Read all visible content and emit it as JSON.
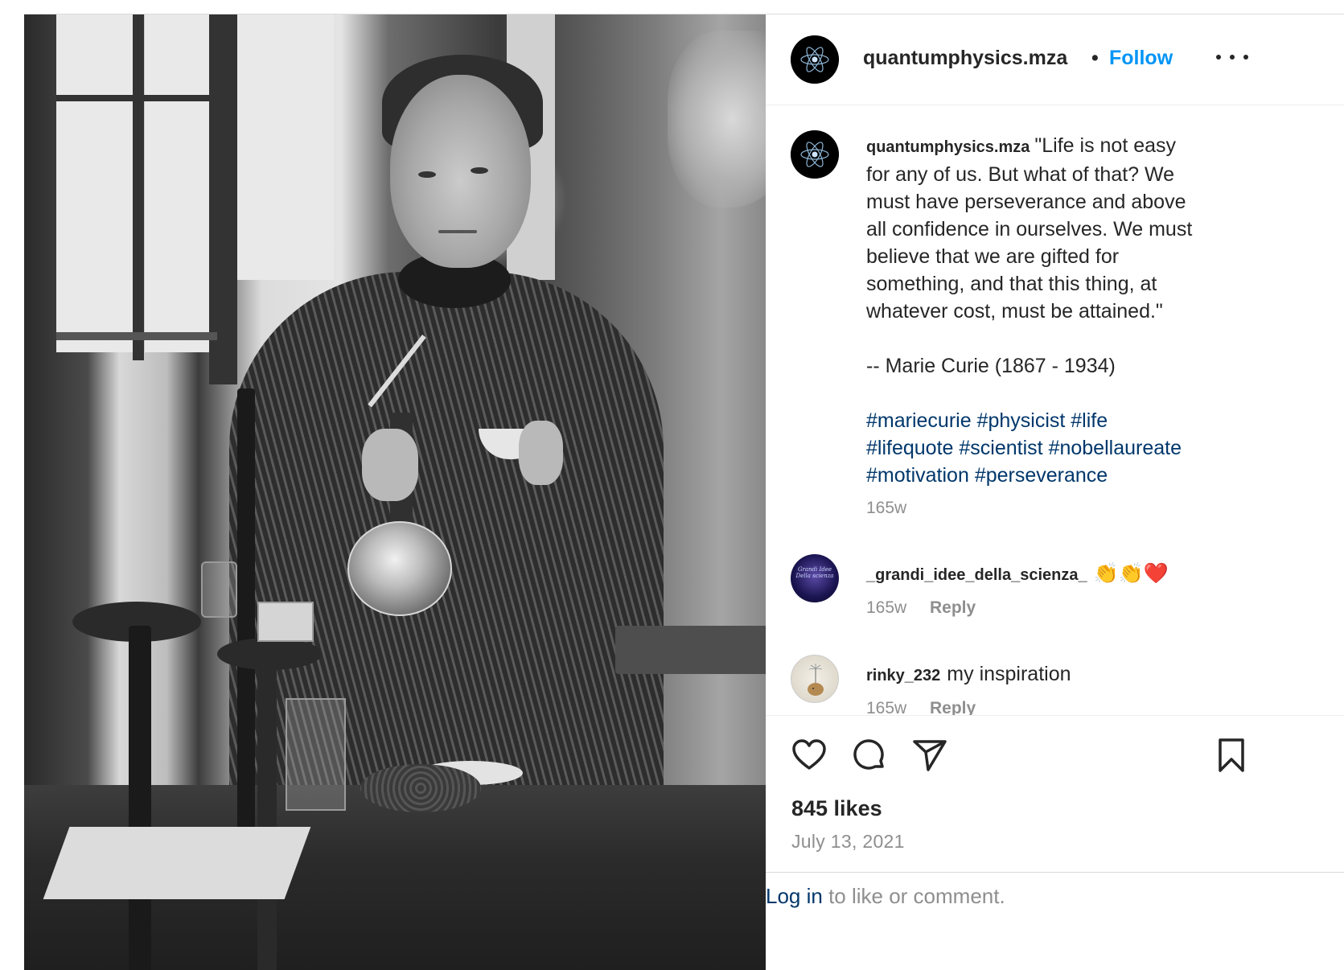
{
  "post": {
    "author": {
      "username": "quantumphysics.mza",
      "avatar_icon": "atom-icon"
    },
    "header": {
      "separator": "•",
      "follow_label": "Follow",
      "more_icon": "more-options-icon"
    },
    "photo": {
      "alt": "Black and white photograph of Marie Curie in her laboratory holding a flask and a small dish"
    },
    "caption": {
      "username": "quantumphysics.mza",
      "quote_lines": [
        "\"Life is not easy",
        "for any of us. But what of that? We",
        "must have perseverance and above",
        "all confidence in ourselves. We must",
        "believe that we are gifted for",
        "something, and that this thing, at",
        "whatever cost, must be attained.\""
      ],
      "attribution": "-- Marie Curie (1867 - 1934)",
      "hashtags": [
        "#mariecurie",
        "#physicist",
        "#life",
        "#lifequote",
        "#scientist",
        "#nobellaureate",
        "#motivation",
        "#perseverance"
      ],
      "time": "165w"
    },
    "comments": [
      {
        "username": "_grandi_idee_della_scienza_",
        "text": "👏👏❤️",
        "time": "165w",
        "reply_label": "Reply",
        "avatar_text": "Grandi Idee Della scienza"
      },
      {
        "username": "rinky_232",
        "text": "my inspiration",
        "time": "165w",
        "reply_label": "Reply"
      }
    ],
    "actions": {
      "like_icon": "heart-icon",
      "comment_icon": "comment-bubble-icon",
      "share_icon": "paper-plane-icon",
      "save_icon": "bookmark-icon"
    },
    "likes": "845 likes",
    "date": "July 13, 2021",
    "footer": {
      "login_label": "Log in",
      "rest_text": " to like or comment."
    }
  },
  "colors": {
    "link_blue": "#0095f6",
    "hashtag_blue": "#00376b",
    "muted_gray": "#8e8e8e",
    "text_dark": "#262626"
  }
}
